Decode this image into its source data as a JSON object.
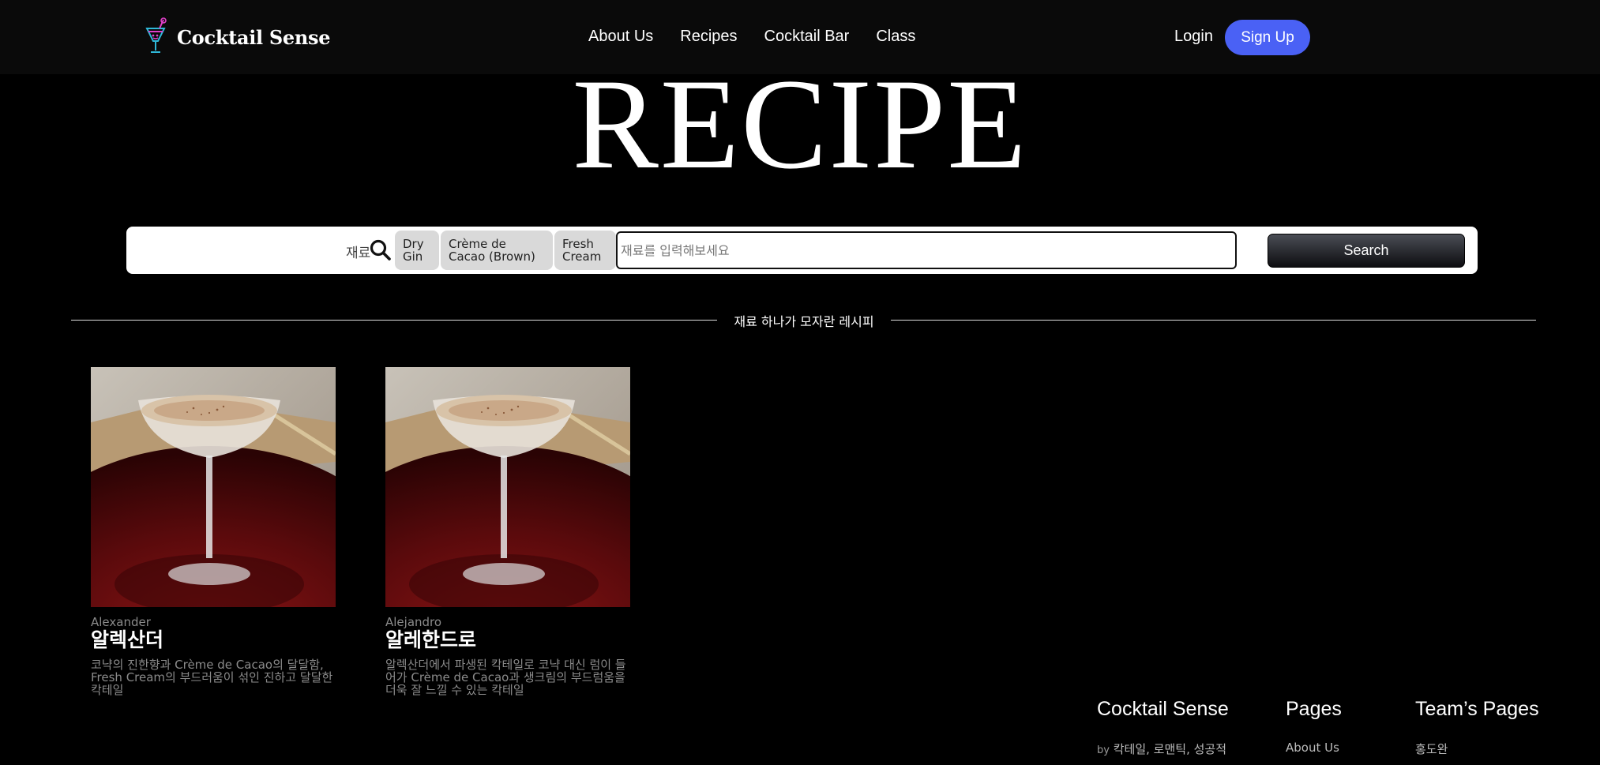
{
  "header": {
    "brand": "Cocktail Sense",
    "logo_icon": "cocktail-glass-icon",
    "nav": [
      "About Us",
      "Recipes",
      "Cocktail Bar",
      "Class"
    ],
    "login": "Login",
    "signup": "Sign Up",
    "signup_color": "#4a61f5"
  },
  "hero": {
    "title": "RECIPE"
  },
  "search": {
    "select_value": "재료",
    "chips": [
      "Dry Gin",
      "Crème de Cacao (Brown)",
      "Fresh Cream"
    ],
    "input_placeholder": "재료를 입력해보세요",
    "button": "Search"
  },
  "section": {
    "title": "재료 하나가 모자란 레시피"
  },
  "cards": [
    {
      "name_en": "Alexander",
      "name_ko": "알렉산더",
      "description": "코냑의 진한향과 Crème de Cacao의 달달함, Fresh Cream의 부드러움이 섞인 진하고 달달한 칵테일"
    },
    {
      "name_en": "Alejandro",
      "name_ko": "알레한드로",
      "description": "알렉산더에서 파생된 칵테일로 코냑 대신 럼이 들어가 Crème de Cacao과 생크림의 부드럼움을 더욱 잘 느낄 수 있는 칵테일"
    }
  ],
  "footer": {
    "brand": {
      "title": "Cocktail Sense",
      "by": "by",
      "authors": "칵테일, 로맨틱, 성공적"
    },
    "pages": {
      "title": "Pages",
      "first": "About Us"
    },
    "team": {
      "title": "Team’s Pages",
      "first": "홍도완"
    }
  }
}
